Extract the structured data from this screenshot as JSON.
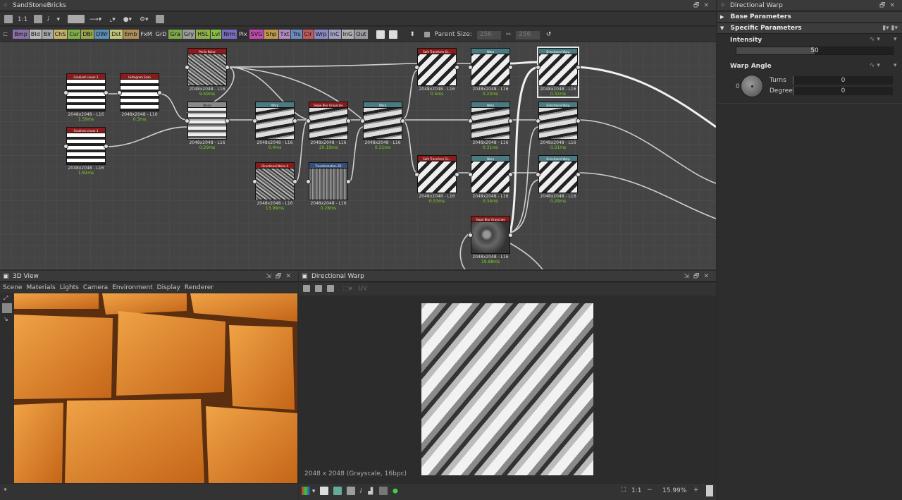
{
  "graph_panel": {
    "title": "SandStoneBricks",
    "zoom": "1:1"
  },
  "node_toolbar": {
    "chips": [
      {
        "label": "Bmp",
        "color": "#8a6fa8"
      },
      {
        "label": "Bld",
        "color": "#b9b9b9"
      },
      {
        "label": "Blr",
        "color": "#a9a9a9"
      },
      {
        "label": "ChS",
        "color": "#c7b26a"
      },
      {
        "label": "Cur",
        "color": "#7fb04a"
      },
      {
        "label": "DBl",
        "color": "#9aa64a"
      },
      {
        "label": "DWr",
        "color": "#5a8fb8"
      },
      {
        "label": "Dst",
        "color": "#c5c57a"
      },
      {
        "label": "Emb",
        "color": "#b08f5a"
      },
      {
        "label": "FxM",
        "color": "#3b3b3b"
      },
      {
        "label": "GrD",
        "color": "#3b3b3b"
      },
      {
        "label": "Gra",
        "color": "#7ea84a"
      },
      {
        "label": "Gry",
        "color": "#9c9c9c"
      },
      {
        "label": "HSL",
        "color": "#8fb04a"
      },
      {
        "label": "Lvl",
        "color": "#86c04a"
      },
      {
        "label": "Nrm",
        "color": "#7a6ac0"
      },
      {
        "label": "Pix",
        "color": "#2e2e2e"
      },
      {
        "label": "SVG",
        "color": "#c04ab0"
      },
      {
        "label": "Shp",
        "color": "#c09a4a"
      },
      {
        "label": "Txt",
        "color": "#b08ac0"
      },
      {
        "label": "Trs",
        "color": "#6a8ac0"
      },
      {
        "label": "Clr",
        "color": "#c05a5a"
      },
      {
        "label": "Wrp",
        "color": "#8a8ac0"
      },
      {
        "label": "InC",
        "color": "#a0a0c0"
      },
      {
        "label": "InG",
        "color": "#b0b0b0"
      },
      {
        "label": "Out",
        "color": "#9a9aa0"
      }
    ],
    "parent_size_label": "Parent Size:",
    "parent_size_w": "256",
    "parent_size_h": "256"
  },
  "nodes": [
    {
      "title": "Gradient Linear 2",
      "res": "2048x2048 - L16",
      "time": "1.59ms",
      "header": "red",
      "thumb": "grad"
    },
    {
      "title": "Histogram Scan",
      "res": "2048x2048 - L16",
      "time": "0.3ms",
      "header": "red",
      "thumb": "grad"
    },
    {
      "title": "Gradient Linear 1",
      "res": "2048x2048 - L16",
      "time": "1.82ms",
      "header": "red",
      "thumb": "grad"
    },
    {
      "title": "Perlin Noise",
      "res": "2048x2048 - L16",
      "time": "9.59ms",
      "header": "red",
      "thumb": "noise"
    },
    {
      "title": "Blend",
      "res": "2048x2048 - L16",
      "time": "0.29ms",
      "header": "grey",
      "thumb": "blend"
    },
    {
      "title": "Warp",
      "res": "2048x2048 - L16",
      "time": "0.4ms",
      "header": "teal",
      "thumb": "warp"
    },
    {
      "title": "Slope Blur Grayscale",
      "res": "2048x2048 - L16",
      "time": "20.19ms",
      "header": "red",
      "thumb": "warp"
    },
    {
      "title": "Warp",
      "res": "2048x2048 - L16",
      "time": "0.31ms",
      "header": "teal",
      "thumb": "warp"
    },
    {
      "title": "Directional Noise 4",
      "res": "2048x2048 - L16",
      "time": "13.99ms",
      "header": "red",
      "thumb": "noise"
    },
    {
      "title": "Transformation 2D",
      "res": "2048x2048 - L16",
      "time": "0.28ms",
      "header": "blue",
      "thumb": "blur"
    },
    {
      "title": "Safe Transform Gr...",
      "res": "2048x2048 - L16",
      "time": "0.5ms",
      "header": "red",
      "thumb": "diag"
    },
    {
      "title": "Warp",
      "res": "2048x2048 - L16",
      "time": "0.23ms",
      "header": "teal",
      "thumb": "diag"
    },
    {
      "title": "Directional Warp",
      "res": "2048x2048 - L16",
      "time": "0.32ms",
      "header": "teal",
      "thumb": "diag",
      "selected": true
    },
    {
      "title": "Warp",
      "res": "2048x2048 - L16",
      "time": "0.31ms",
      "header": "teal",
      "thumb": "warp"
    },
    {
      "title": "Directional Warp",
      "res": "2048x2048 - L16",
      "time": "0.31ms",
      "header": "teal",
      "thumb": "warp"
    },
    {
      "title": "Safe Transform Gr...",
      "res": "2048x2048 - L16",
      "time": "0.53ms",
      "header": "red",
      "thumb": "diag"
    },
    {
      "title": "Warp",
      "res": "2048x2048 - L16",
      "time": "0.34ms",
      "header": "teal",
      "thumb": "diag"
    },
    {
      "title": "Directional Warp",
      "res": "2048x2048 - L16",
      "time": "0.29ms",
      "header": "teal",
      "thumb": "diag"
    },
    {
      "title": "Slope Blur Grayscale",
      "res": "2048x2048 - L16",
      "time": "19.88ms",
      "header": "red",
      "thumb": "dark"
    }
  ],
  "view3d": {
    "title": "3D View",
    "menu": [
      "Scene",
      "Materials",
      "Lights",
      "Camera",
      "Environment",
      "Display",
      "Renderer"
    ]
  },
  "view2d": {
    "title": "Directional Warp",
    "uv_label": "UV",
    "info": "2048 x 2048 (Grayscale, 16bpc)",
    "zoom_ratio": "1:1",
    "zoom_percent": "15.99%"
  },
  "properties": {
    "title": "Directional Warp",
    "sections": [
      {
        "label": "Base Parameters",
        "expanded": false
      },
      {
        "label": "Specific Parameters",
        "expanded": true
      }
    ],
    "intensity": {
      "label": "Intensity",
      "value": "50",
      "fraction": 0.5
    },
    "warp_angle": {
      "label": "Warp Angle",
      "dial_zero": "0",
      "turns_label": "Turns",
      "turns_value": "0",
      "degrees_label": "Degrees",
      "degrees_value": "0"
    }
  }
}
